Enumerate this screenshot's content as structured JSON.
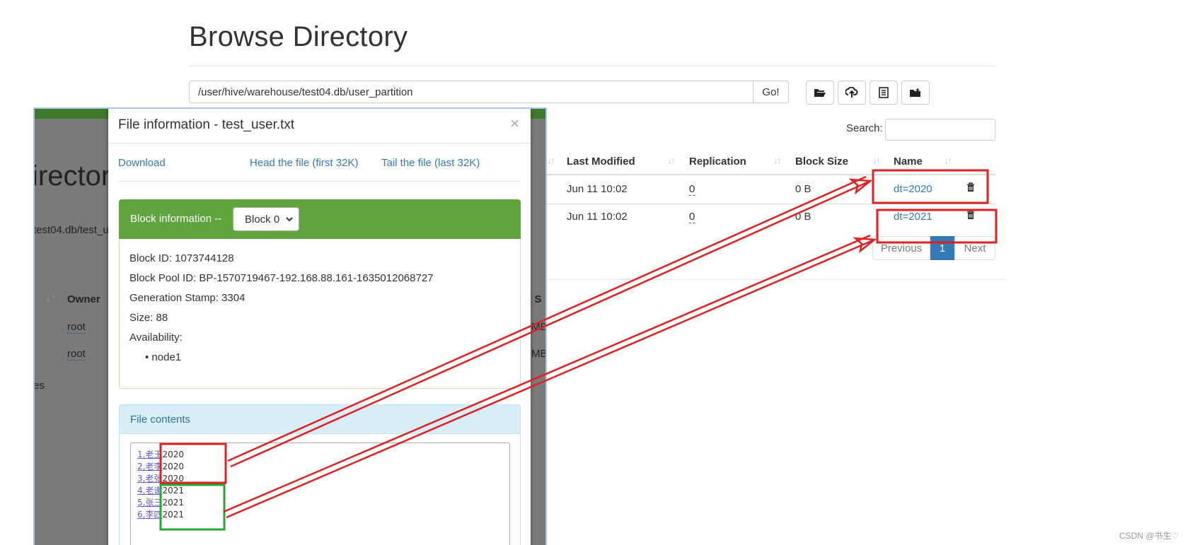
{
  "page": {
    "title": "Browse Directory",
    "path": "/user/hive/warehouse/test04.db/user_partition",
    "go_label": "Go!",
    "toolbar_icons": [
      "open-folder-icon",
      "upload-icon",
      "list-icon",
      "create-folder-icon"
    ],
    "search_label": "Search:",
    "search_value": ""
  },
  "table": {
    "headers": [
      "Last Modified",
      "Replication",
      "Block Size",
      "Name"
    ],
    "rows": [
      {
        "modified": "Jun 11 10:02",
        "replication": "0",
        "block_size": "0 B",
        "name": "dt=2020"
      },
      {
        "modified": "Jun 11 10:02",
        "replication": "0",
        "block_size": "0 B",
        "name": "dt=2021"
      }
    ]
  },
  "pagination": {
    "previous": "Previous",
    "current": "1",
    "next": "Next"
  },
  "background_shot": {
    "title_fragment": "irector",
    "path_fragment": "test04.db/test_u",
    "owner_header": "Owner",
    "owner_values": [
      "root",
      "root"
    ],
    "col_fragment": "k S",
    "size_fragments": [
      "MB",
      "MB"
    ],
    "footer_fragment": "es"
  },
  "modal": {
    "title": "File information - test_user.txt",
    "close": "×",
    "links": {
      "download": "Download",
      "head": "Head the file (first 32K)",
      "tail": "Tail the file (last 32K)"
    },
    "block_info_label": "Block information --",
    "block_select": "Block 0",
    "block_id": "Block ID: 1073744128",
    "pool_id": "Block Pool ID: BP-1570719467-192.168.88.161-1635012068727",
    "gen_stamp": "Generation Stamp: 3304",
    "size": "Size: 88",
    "availability": "Availability:",
    "nodes": [
      "node1"
    ],
    "file_contents_label": "File contents",
    "lines": [
      {
        "pre": "1,老王",
        "year": "2020"
      },
      {
        "pre": "2,老李",
        "year": "2020"
      },
      {
        "pre": "3,老张",
        "year": "2020"
      },
      {
        "pre": "4,老谢",
        "year": "2021"
      },
      {
        "pre": "5,张三",
        "year": "2021"
      },
      {
        "pre": "6,李四",
        "year": "2021"
      }
    ]
  },
  "annotations": {
    "red": "#e02020",
    "green": "#22aa33"
  },
  "watermark": "CSDN @书生♡"
}
